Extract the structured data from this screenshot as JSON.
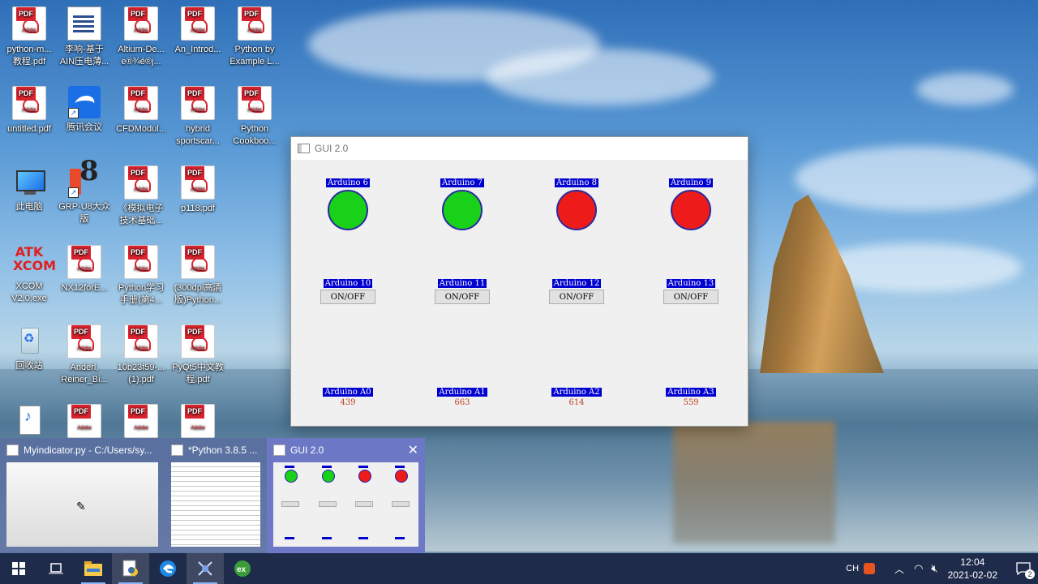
{
  "desktop": {
    "icons": [
      {
        "label": "python-m...\n教程.pdf",
        "icon": "pdf-icon"
      },
      {
        "label": "李响-基于\nAIN压电薄...",
        "icon": "document-icon"
      },
      {
        "label": "Altium-De...\ne®¾é®j...",
        "icon": "pdf-icon"
      },
      {
        "label": "An_Introd...",
        "icon": "pdf-icon"
      },
      {
        "label": "Python by\nExample L...",
        "icon": "pdf-icon"
      },
      {
        "label": "untitled.pdf",
        "icon": "pdf-icon"
      },
      {
        "label": "腾讯会议",
        "icon": "tencent-meeting-icon"
      },
      {
        "label": "CFDModul...",
        "icon": "pdf-icon"
      },
      {
        "label": "hybrid\nsportscar...",
        "icon": "pdf-icon"
      },
      {
        "label": "Python\nCookboo...",
        "icon": "pdf-icon"
      },
      {
        "label": "此电脑",
        "icon": "this-pc-icon"
      },
      {
        "label": "GRP-U8大众\n版",
        "icon": "grp-u8-icon"
      },
      {
        "label": "《模拟电子\n技术基础...",
        "icon": "pdf-icon"
      },
      {
        "label": "p118.pdf",
        "icon": "pdf-icon"
      },
      {
        "label": "XCOM\nV2.0.exe",
        "icon": "atk-xcom-icon",
        "logo": "ATK\nXCOM"
      },
      {
        "label": "NX12forE...",
        "icon": "pdf-icon"
      },
      {
        "label": "Python学习\n手册(第4...",
        "icon": "pdf-icon"
      },
      {
        "label": "(300dpi高清\n版)Python...",
        "icon": "pdf-icon"
      },
      {
        "label": "回收站",
        "icon": "recycle-bin-icon"
      },
      {
        "label": "Anderl,\nReiner_Bi...",
        "icon": "pdf-icon"
      },
      {
        "label": "10b23f59-...\n(1).pdf",
        "icon": "pdf-icon"
      },
      {
        "label": "PyQt5中文教\n程.pdf",
        "icon": "pdf-icon"
      }
    ]
  },
  "gui": {
    "title": "GUI 2.0",
    "leds": [
      {
        "label": "Arduino 6",
        "state": "on",
        "color": "#19d119"
      },
      {
        "label": "Arduino 7",
        "state": "on",
        "color": "#19d119"
      },
      {
        "label": "Arduino 8",
        "state": "off",
        "color": "#ee1b1b"
      },
      {
        "label": "Arduino 9",
        "state": "off",
        "color": "#ee1b1b"
      }
    ],
    "toggles": [
      {
        "label": "Arduino 10",
        "button": "ON/OFF"
      },
      {
        "label": "Arduino 11",
        "button": "ON/OFF"
      },
      {
        "label": "Arduino 12",
        "button": "ON/OFF"
      },
      {
        "label": "Arduino 13",
        "button": "ON/OFF"
      }
    ],
    "analog": [
      {
        "label": "Arduino A0",
        "value": "439"
      },
      {
        "label": "Arduino A1",
        "value": "663"
      },
      {
        "label": "Arduino A2",
        "value": "614"
      },
      {
        "label": "Arduino A3",
        "value": "559"
      }
    ]
  },
  "previews": [
    {
      "title": "Myindicator.py - C:/Users/sy..."
    },
    {
      "title": "*Python 3.8.5 ..."
    },
    {
      "title": "GUI 2.0"
    }
  ],
  "taskbar": {
    "apps": [
      "start-button",
      "task-view",
      "file-explorer",
      "python-idle",
      "edge",
      "snipping-tool",
      "excel"
    ],
    "tray": {
      "ime": "CH",
      "clock_time": "12:04",
      "clock_date": "2021-02-02",
      "notifications": "2"
    }
  }
}
